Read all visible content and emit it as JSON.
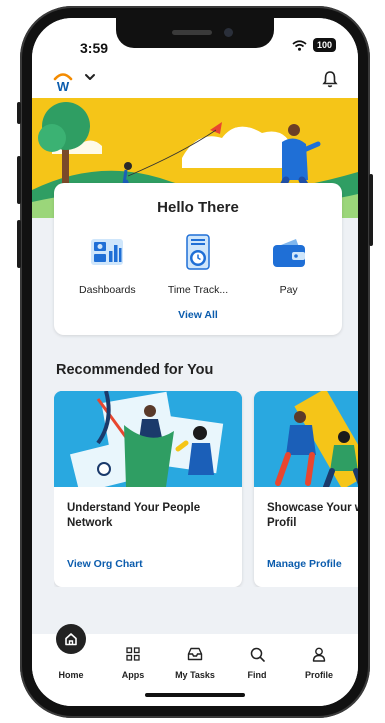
{
  "status_bar": {
    "time": "3:59",
    "battery": "100"
  },
  "app_bar": {
    "logo_letter": "W"
  },
  "greeting_card": {
    "title": "Hello There",
    "quick_links": [
      {
        "label": "Dashboards",
        "icon": "dashboards-icon"
      },
      {
        "label": "Time Track...",
        "icon": "time-tracking-icon"
      },
      {
        "label": "Pay",
        "icon": "pay-icon"
      }
    ],
    "view_all": "View All"
  },
  "recommended": {
    "title": "Recommended for You",
    "cards": [
      {
        "title": "Understand Your People Network",
        "action": "View Org Chart"
      },
      {
        "title": "Showcase Your with Your Profil",
        "action": "Manage Profile"
      }
    ]
  },
  "tab_bar": {
    "tabs": [
      {
        "label": "Home",
        "icon": "home-icon",
        "active": true
      },
      {
        "label": "Apps",
        "icon": "apps-grid-icon"
      },
      {
        "label": "My Tasks",
        "icon": "inbox-icon"
      },
      {
        "label": "Find",
        "icon": "search-icon"
      },
      {
        "label": "Profile",
        "icon": "person-icon"
      }
    ]
  },
  "colors": {
    "accent_blue": "#0b5cad",
    "hero_yellow": "#f5c518",
    "brand_orange": "#f38b00"
  }
}
